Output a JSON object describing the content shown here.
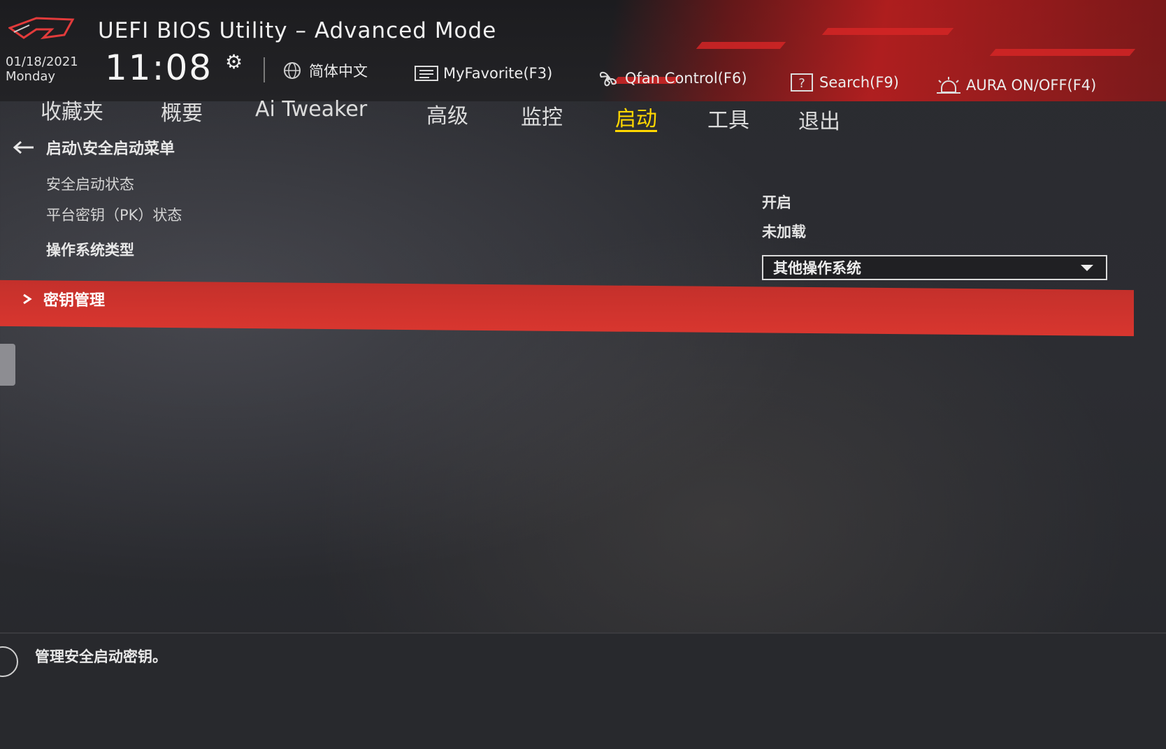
{
  "app": {
    "title": "UEFI BIOS Utility – Advanced Mode",
    "date": "01/18/2021",
    "weekday": "Monday",
    "time": "11:08"
  },
  "toolbar": {
    "language": "简体中文",
    "myfavorite": "MyFavorite(F3)",
    "qfan": "Qfan Control(F6)",
    "search": "Search(F9)",
    "aura": "AURA ON/OFF(F4)"
  },
  "tabs": [
    {
      "label": "收藏夹",
      "active": false
    },
    {
      "label": "概要",
      "active": false
    },
    {
      "label": "Ai Tweaker",
      "active": false
    },
    {
      "label": "高级",
      "active": false
    },
    {
      "label": "监控",
      "active": false
    },
    {
      "label": "启动",
      "active": true
    },
    {
      "label": "工具",
      "active": false
    },
    {
      "label": "退出",
      "active": false
    }
  ],
  "breadcrumb": "启动\\安全启动菜单",
  "settings": {
    "secure_boot_state_label": "安全启动状态",
    "secure_boot_state_value": "开启",
    "pk_state_label": "平台密钥（PK）状态",
    "pk_state_value": "未加载",
    "os_type_label": "操作系统类型",
    "os_type_value": "其他操作系统"
  },
  "selected_item": "密钥管理",
  "help_text": "管理安全启动密钥。",
  "colors": {
    "accent_red": "#d8362f",
    "active_tab": "#ffd700"
  }
}
